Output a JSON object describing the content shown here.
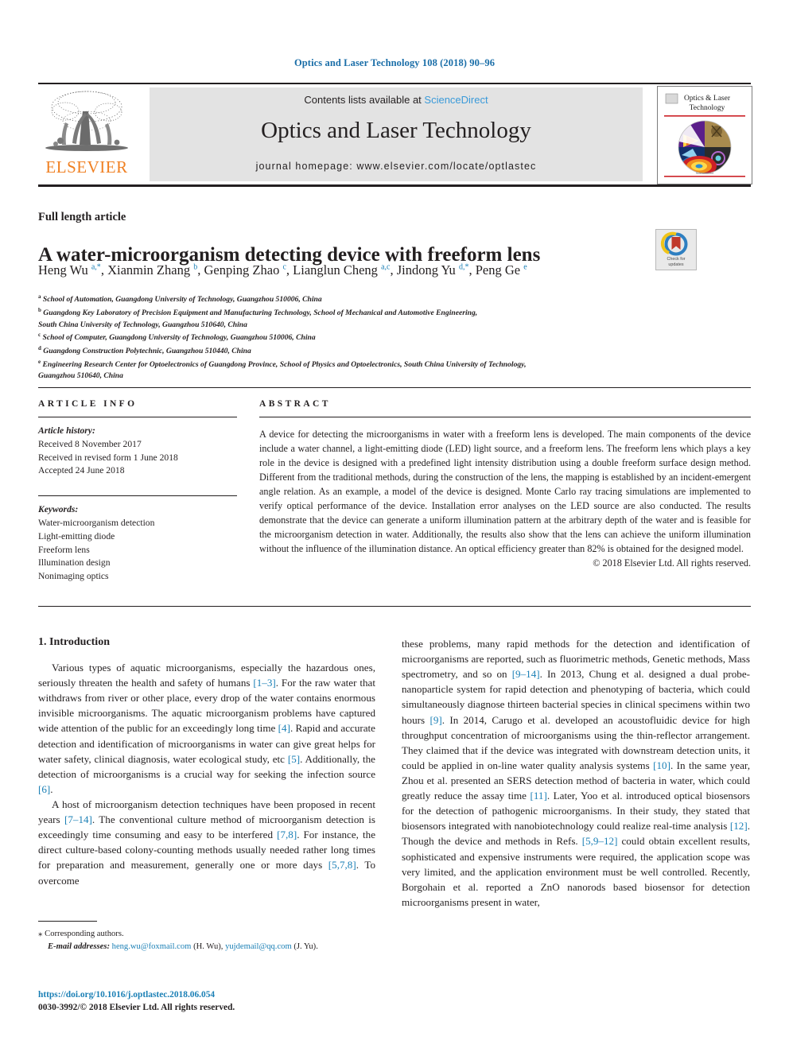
{
  "running_head": "Optics and Laser Technology 108 (2018) 90–96",
  "masthead": {
    "contents_prefix": "Contents lists available at ",
    "sciencedirect": "ScienceDirect",
    "journal_title": "Optics and Laser Technology",
    "journal_homepage": "journal homepage: www.elsevier.com/locate/optlastec",
    "publisher_name": "ELSEVIER",
    "cover_title_line1": "Optics & Laser",
    "cover_title_line2": "Technology",
    "colors": {
      "link_blue": "#3a9ad9",
      "elsevier_orange": "#f08022",
      "panel_gray": "#e3e3e3",
      "running_head_blue": "#1a6ea8"
    }
  },
  "article": {
    "type": "Full length article",
    "title": "A water-microorganism detecting device with freeform lens",
    "authors_html": "Heng Wu <sup>a,*</sup>, Xianmin Zhang <sup>b</sup>, Genping Zhao <sup>c</sup>, Lianglun Cheng <sup>a,c</sup>, Jindong Yu <sup>d,*</sup>, Peng Ge <sup>e</sup>",
    "crossmark_line1": "Check for",
    "crossmark_line2": "updates",
    "affiliations_html": "<sup>a</sup> School of Automation, Guangdong University of Technology, Guangzhou 510006, China<br><sup>b</sup> Guangdong Key Laboratory of Precision Equipment and Manufacturing Technology, School of Mechanical and Automotive Engineering,<br>South China University of Technology, Guangzhou 510640, China<br><sup>c</sup> School of Computer, Guangdong University of Technology, Guangzhou 510006, China<br><sup>d</sup> Guangdong Construction Polytechnic, Guangzhou 510440, China<br><sup>e</sup> Engineering Research Center for Optoelectronics of Guangdong Province, School of Physics and Optoelectronics, South China University of Technology,<br>Guangzhou 510640, China"
  },
  "article_info": {
    "heading": "ARTICLE INFO",
    "history_label": "Article history:",
    "history": [
      "Received 8 November 2017",
      "Received in revised form 1 June 2018",
      "Accepted 24 June 2018"
    ],
    "keywords_label": "Keywords:",
    "keywords": [
      "Water-microorganism detection",
      "Light-emitting diode",
      "Freeform lens",
      "Illumination design",
      "Nonimaging optics"
    ]
  },
  "abstract": {
    "heading": "ABSTRACT",
    "text": "A device for detecting the microorganisms in water with a freeform lens is developed. The main components of the device include a water channel, a light-emitting diode (LED) light source, and a freeform lens. The freeform lens which plays a key role in the device is designed with a predefined light intensity distribution using a double freeform surface design method. Different from the traditional methods, during the construction of the lens, the mapping is established by an incident-emergent angle relation. As an example, a model of the device is designed. Monte Carlo ray tracing simulations are implemented to verify optical performance of the device. Installation error analyses on the LED source are also conducted. The results demonstrate that the device can generate a uniform illumination pattern at the arbitrary depth of the water and is feasible for the microorganism detection in water. Additionally, the results also show that the lens can achieve the uniform illumination without the influence of the illumination distance. An optical efficiency greater than 82% is obtained for the designed model.",
    "copyright": "© 2018 Elsevier Ltd. All rights reserved."
  },
  "body": {
    "section_heading": "1. Introduction",
    "left_paragraph_1_html": "Various types of aquatic microorganisms, especially the hazardous ones, seriously threaten the health and safety of humans <span class=\"ref\">[1–3]</span>. For the raw water that withdraws from river or other place, every drop of the water contains enormous invisible microorganisms. The aquatic microorganism problems have captured wide attention of the public for an exceedingly long time <span class=\"ref\">[4]</span>. Rapid and accurate detection and identification of microorganisms in water can give great helps for water safety, clinical diagnosis, water ecological study, etc <span class=\"ref\">[5]</span>. Additionally, the detection of microorganisms is a crucial way for seeking the infection source <span class=\"ref\">[6]</span>.",
    "left_paragraph_2_html": "A host of microorganism detection techniques have been proposed in recent years <span class=\"ref\">[7–14]</span>. The conventional culture method of microorganism detection is exceedingly time consuming and easy to be interfered <span class=\"ref\">[7,8]</span>. For instance, the direct culture-based colony-counting methods usually needed rather long times for preparation and measurement, generally one or more days <span class=\"ref\">[5,7,8]</span>. To overcome",
    "right_paragraph_html": "these problems, many rapid methods for the detection and identification of microorganisms are reported, such as fluorimetric methods, Genetic methods, Mass spectrometry, and so on <span class=\"ref\">[9–14]</span>. In 2013, Chung et al. designed a dual probe-nanoparticle system for rapid detection and phenotyping of bacteria, which could simultaneously diagnose thirteen bacterial species in clinical specimens within two hours <span class=\"ref\">[9]</span>. In 2014, Carugo et al. developed an acoustofluidic device for high throughput concentration of microorganisms using the thin-reflector arrangement. They claimed that if the device was integrated with downstream detection units, it could be applied in on-line water quality analysis systems <span class=\"ref\">[10]</span>. In the same year, Zhou et al. presented an SERS detection method of bacteria in water, which could greatly reduce the assay time <span class=\"ref\">[11]</span>. Later, Yoo et al. introduced optical biosensors for the detection of pathogenic microorganisms. In their study, they stated that biosensors integrated with nanobiotechnology could realize real-time analysis <span class=\"ref\">[12]</span>. Though the device and methods in Refs. <span class=\"ref\">[5,9–12]</span> could obtain excellent results, sophisticated and expensive instruments were required, the application scope was very limited, and the application environment must be well controlled. Recently, Borgohain et al. reported a ZnO nanorods based biosensor for detection microorganisms present in water,"
  },
  "footnote": {
    "corresponding_marker": "⁎",
    "corresponding_text": "Corresponding authors.",
    "email_label": "E-mail addresses:",
    "email_html": "<span class=\"mail\">heng.wu@foxmail.com</span> (H. Wu), <span class=\"mail\">yujdemail@qq.com</span> (J. Yu).",
    "doi": "https://doi.org/10.1016/j.optlastec.2018.06.054",
    "issn_line": "0030-3992/© 2018 Elsevier Ltd. All rights reserved."
  }
}
